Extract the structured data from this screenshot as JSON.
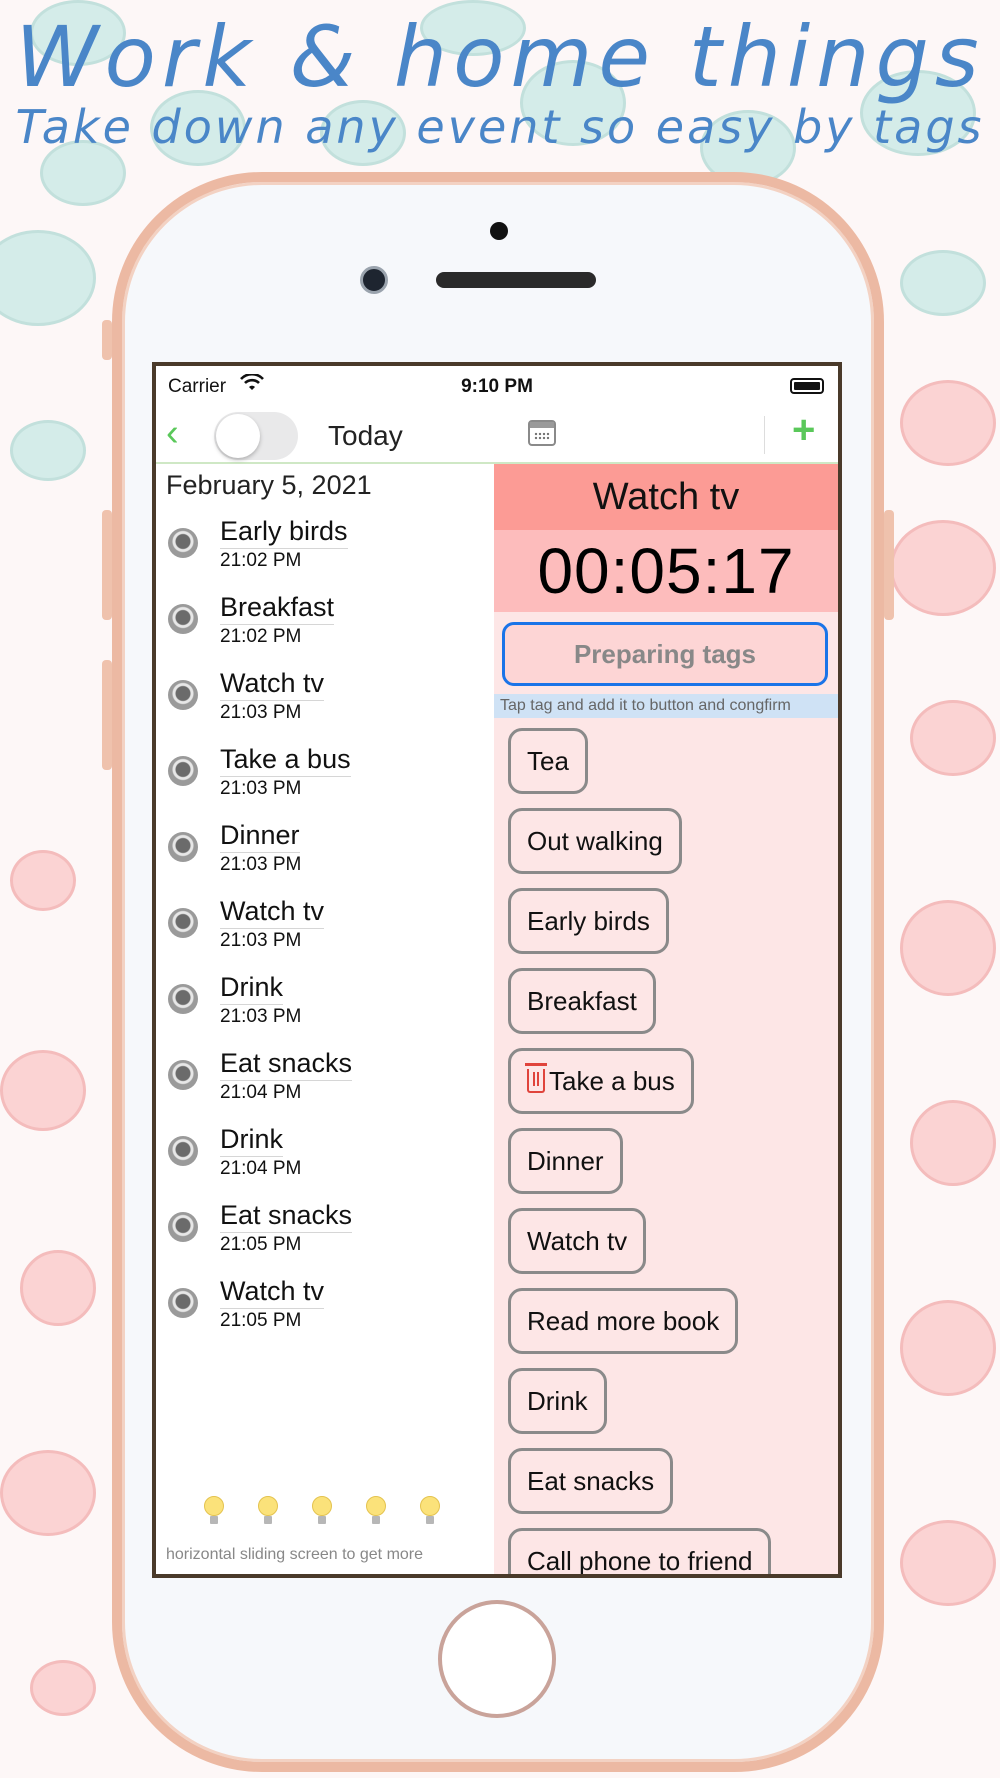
{
  "headline": {
    "title": "Work & home things",
    "subtitle": "Take down any event so easy by tags"
  },
  "status_bar": {
    "carrier": "Carrier",
    "time": "9:10 PM"
  },
  "nav": {
    "title": "Today",
    "toggle_on": false
  },
  "event_list": {
    "date": "February 5, 2021",
    "items": [
      {
        "name": "Early birds",
        "time": "21:02 PM"
      },
      {
        "name": "Breakfast",
        "time": "21:02 PM"
      },
      {
        "name": "Watch tv",
        "time": "21:03 PM"
      },
      {
        "name": "Take a bus",
        "time": "21:03 PM"
      },
      {
        "name": "Dinner",
        "time": "21:03 PM"
      },
      {
        "name": "Watch tv",
        "time": "21:03 PM"
      },
      {
        "name": "Drink",
        "time": "21:03 PM"
      },
      {
        "name": "Eat snacks",
        "time": "21:04 PM"
      },
      {
        "name": "Drink",
        "time": "21:04 PM"
      },
      {
        "name": "Eat snacks",
        "time": "21:05 PM"
      },
      {
        "name": "Watch tv",
        "time": "21:05 PM"
      }
    ],
    "bulb_count": 5,
    "hint": "horizontal sliding screen to get more"
  },
  "current": {
    "name": "Watch tv",
    "timer": "00:05:17",
    "preparing_label": "Preparing tags",
    "tip": "Tap tag and add it to button and congfirm"
  },
  "tags": [
    {
      "label": "Tea",
      "icon": null
    },
    {
      "label": "Out walking",
      "icon": null
    },
    {
      "label": "Early birds",
      "icon": null
    },
    {
      "label": "Breakfast",
      "icon": null
    },
    {
      "label": "Take a bus",
      "icon": "trash-icon"
    },
    {
      "label": "Dinner",
      "icon": null
    },
    {
      "label": "Watch tv",
      "icon": null
    },
    {
      "label": "Read more book",
      "icon": null
    },
    {
      "label": "Drink",
      "icon": null
    },
    {
      "label": "Eat snacks",
      "icon": null
    },
    {
      "label": "Call phone to friend",
      "icon": null
    }
  ],
  "colors": {
    "accent_green": "#5ac85a",
    "current_header": "#fc9b95",
    "timer_bg": "#fdbcbc",
    "panel_bg": "#fde6e6",
    "focus_blue": "#1a74e8",
    "headline_blue": "#4a86c8",
    "phone_frame": "#ecb9a3"
  }
}
